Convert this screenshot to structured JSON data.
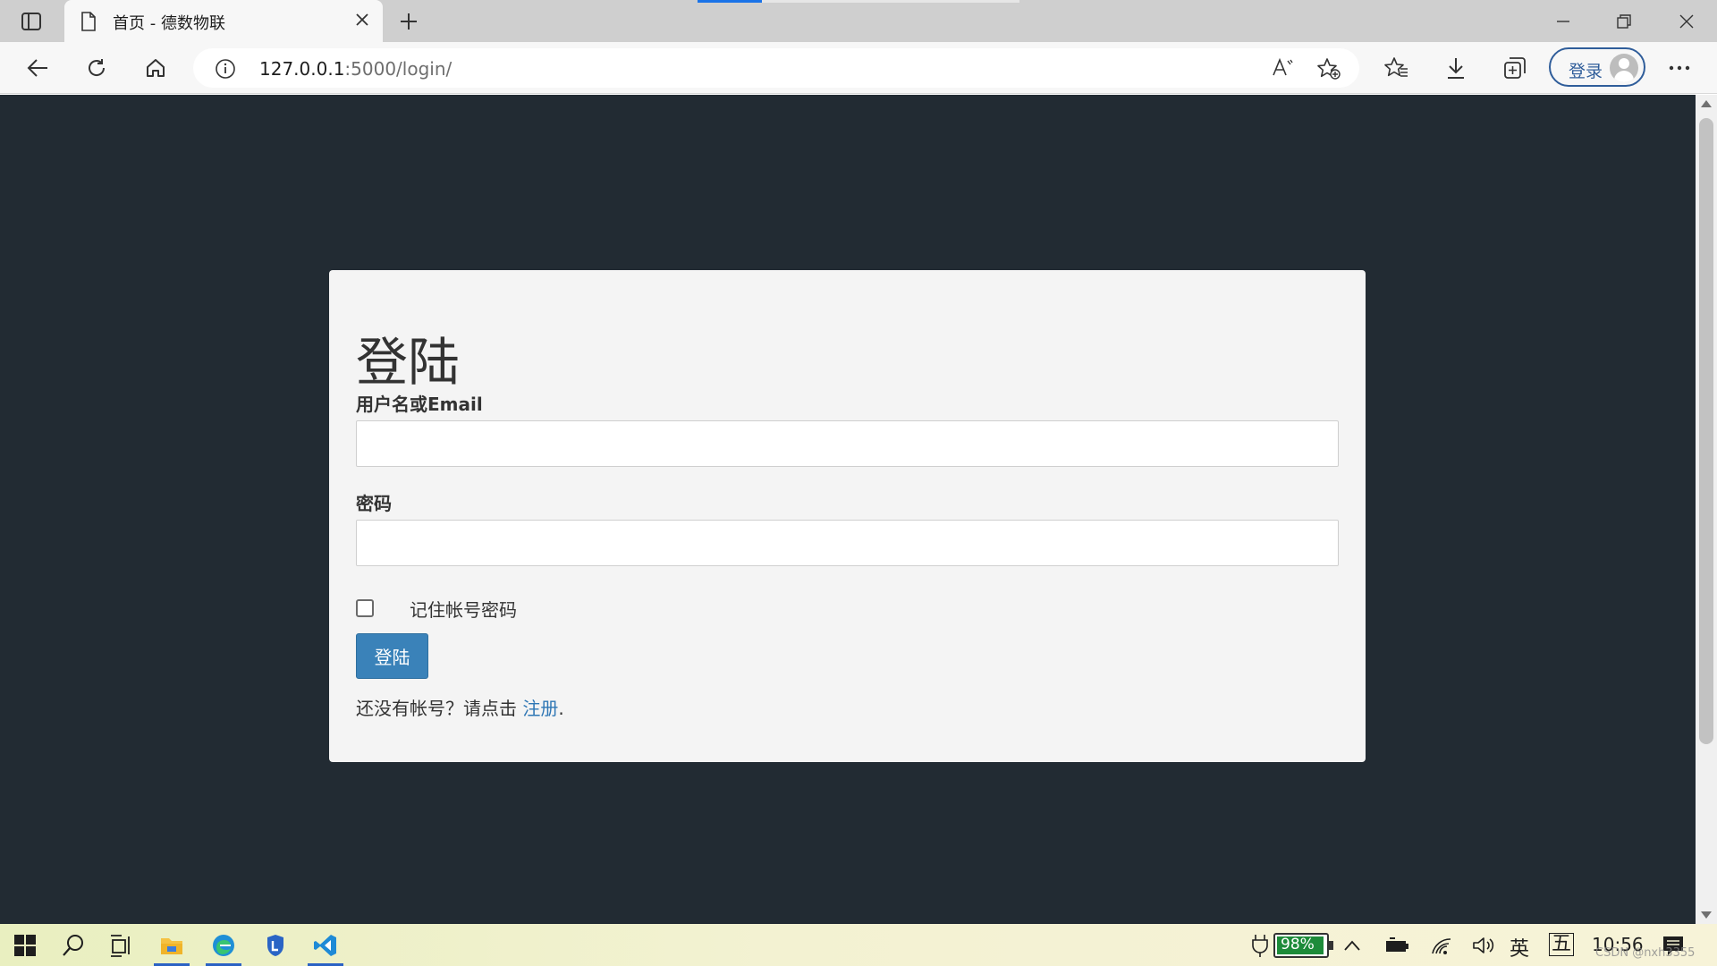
{
  "browser": {
    "tab": {
      "title": "首页 - 德数物联"
    },
    "address": {
      "host": "127.0.0.1",
      "path": ":5000/login/"
    },
    "profile": {
      "signin_label": "登录"
    }
  },
  "page": {
    "title": "登陆",
    "username_label": "用户名或Email",
    "password_label": "密码",
    "remember_label": "记住帐号密码",
    "remember_checked": false,
    "login_button": "登陆",
    "register_prompt": "还没有帐号？请点击",
    "register_link": "注册",
    "register_suffix": "."
  },
  "taskbar": {
    "battery_percent": "98%",
    "ime_lang": "英",
    "ime_mode": "五",
    "time": "10:56",
    "watermark": "CSDN @nxh3355"
  },
  "colors": {
    "page_background": "#222b33",
    "card_background": "#f4f4f4",
    "button_primary": "#3a82b9",
    "link": "#2f77b5"
  }
}
